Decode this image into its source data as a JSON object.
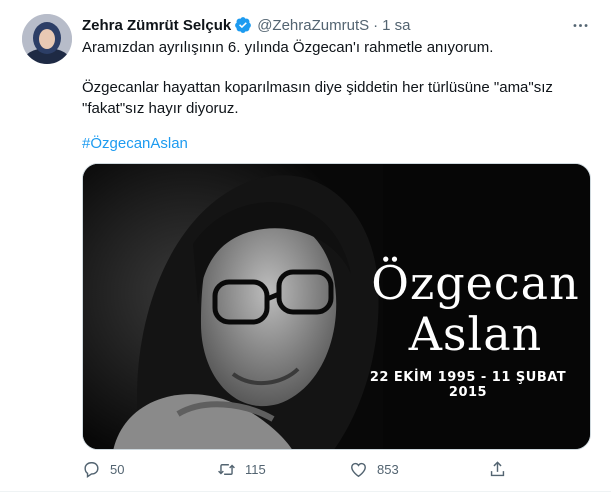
{
  "tweet": {
    "author_name": "Zehra Zümrüt Selçuk",
    "handle": "@ZehraZumrutS",
    "separator": "·",
    "time": "1 sa",
    "paragraph1": "Aramızdan ayrılışının 6. yılında Özgecan'ı rahmetle anıyorum.",
    "paragraph2_line1": "Özgecanlar hayattan koparılmasın diye şiddetin her türlüsüne \"ama\"sız",
    "paragraph2_line2": "\"fakat\"sız hayır diyoruz.",
    "hashtag": "#ÖzgecanAslan"
  },
  "media": {
    "title_line1": "Özgecan",
    "title_line2": "Aslan",
    "dates": "22 EKİM 1995 - 11 ŞUBAT 2015"
  },
  "actions": {
    "replies": "50",
    "retweets": "115",
    "likes": "853"
  },
  "colors": {
    "link": "#1d9bf0",
    "secondary_text": "#536471",
    "verified": "#1d9bf0"
  },
  "icons": [
    "more-icon",
    "verified-icon",
    "reply-icon",
    "retweet-icon",
    "like-icon",
    "share-icon"
  ]
}
